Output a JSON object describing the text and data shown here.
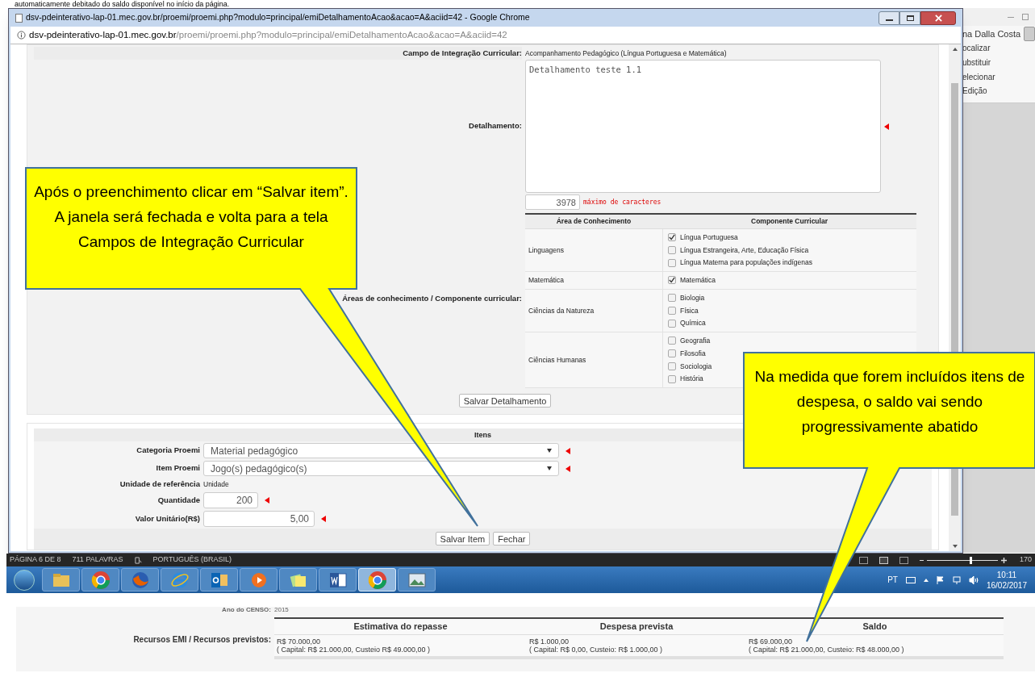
{
  "document_top_text": "automaticamente debitado do saldo disponível no início da página.",
  "browser": {
    "title": "dsv-pdeinterativo-lap-01.mec.gov.br/proemi/proemi.php?modulo=principal/emiDetalhamentoAcao&acao=A&aciid=42 - Google Chrome",
    "address_host": "dsv-pdeinterativo-lap-01.mec.gov.br",
    "address_path": "/proemi/proemi.php?modulo=principal/emiDetalhamentoAcao&acao=A&aciid=42"
  },
  "detail_form": {
    "campo_label": "Campo de Integração Curricular:",
    "campo_value": "Acompanhamento Pedagógico (Língua Portuguesa e Matemática)",
    "detalhamento_label": "Detalhamento:",
    "detalhamento_value": "Detalhamento teste 1.1",
    "detalhamento_required": true,
    "char_count": "3978",
    "char_hint": "máximo de caracteres",
    "areas_label": "Áreas de conhecimento / Componente curricular:",
    "table": {
      "columns": [
        "Área de Conhecimento",
        "Componente Curricular"
      ],
      "rows": [
        {
          "area": "Linguagens",
          "components": [
            {
              "label": "Língua Portuguesa",
              "checked": true
            },
            {
              "label": "Língua Estrangeira, Arte, Educação Física",
              "checked": false
            },
            {
              "label": "Língua Materna para populações indígenas",
              "checked": false
            }
          ]
        },
        {
          "area": "Matemática",
          "components": [
            {
              "label": "Matemática",
              "checked": true
            }
          ]
        },
        {
          "area": "Ciências da Natureza",
          "components": [
            {
              "label": "Biologia",
              "checked": false
            },
            {
              "label": "Física",
              "checked": false
            },
            {
              "label": "Química",
              "checked": false
            }
          ]
        },
        {
          "area": "Ciências Humanas",
          "components": [
            {
              "label": "Geografia",
              "checked": false
            },
            {
              "label": "Filosofia",
              "checked": false
            },
            {
              "label": "Sociologia",
              "checked": false
            },
            {
              "label": "História",
              "checked": false
            }
          ]
        }
      ]
    },
    "save_button": "Salvar Detalhamento"
  },
  "items": {
    "title": "Itens",
    "fields": [
      {
        "kind": "select",
        "label": "Categoria Proemi",
        "value": "Material pedagógico",
        "required": true
      },
      {
        "kind": "select",
        "label": "Item Proemi",
        "value": "Jogo(s) pedagógico(s)",
        "required": true
      },
      {
        "kind": "text",
        "label": "Unidade de referência",
        "value": "Unidade"
      },
      {
        "kind": "short",
        "label": "Quantidade",
        "value": "200",
        "required": true
      },
      {
        "kind": "medium",
        "label": "Valor Unitário(R$)",
        "value": "5,00",
        "required": true
      }
    ],
    "buttons": [
      "Salvar Item",
      "Fechar"
    ]
  },
  "word": {
    "user": "na Dalla Costa",
    "ribbon": [
      "ocalizar",
      "ubstituir",
      "elecionar"
    ],
    "ribbon_group": "Edição",
    "status": [
      "PÁGINA 6 DE 8",
      "711 PALAVRAS",
      "PORTUGUÊS (BRASIL)"
    ],
    "zoom": {
      "level": 0.6,
      "reading": "170"
    }
  },
  "taskbar": {
    "apps": [
      {
        "kind": "folder",
        "selected": false
      },
      {
        "kind": "chrome",
        "selected": false
      },
      {
        "kind": "firefox",
        "selected": false
      },
      {
        "kind": "ie",
        "selected": false
      },
      {
        "kind": "outlook",
        "selected": false
      },
      {
        "kind": "media",
        "selected": false
      },
      {
        "kind": "notes",
        "selected": false
      },
      {
        "kind": "word",
        "selected": false
      },
      {
        "kind": "chrome",
        "selected": true
      },
      {
        "kind": "picture",
        "selected": false
      }
    ],
    "language": "PT",
    "time": "10:11",
    "date": "16/02/2017"
  },
  "resources": {
    "partial_label": "Ano do CENSO:",
    "partial_value": "2015",
    "label": "Recursos EMI / Recursos previstos:",
    "columns": [
      {
        "heading": "Estimativa do repasse",
        "value": "R$ 70.000,00",
        "detail": "( Capital: R$ 21.000,00, Custeio R$ 49.000,00 )"
      },
      {
        "heading": "Despesa prevista",
        "value": "R$ 1.000,00",
        "detail": "( Capital: R$ 0,00, Custeio: R$ 1.000,00 )"
      },
      {
        "heading": "Saldo",
        "value": "R$ 69.000,00",
        "detail": "( Capital: R$ 21.000,00, Custeio: R$ 48.000,00 )"
      }
    ]
  },
  "callouts": [
    "Após o preenchimento clicar em “Salvar item”. A janela será fechada e volta para a tela Campos de Integração Curricular",
    "Na medida que forem incluídos itens de despesa, o saldo vai sendo progressivamente abatido"
  ]
}
